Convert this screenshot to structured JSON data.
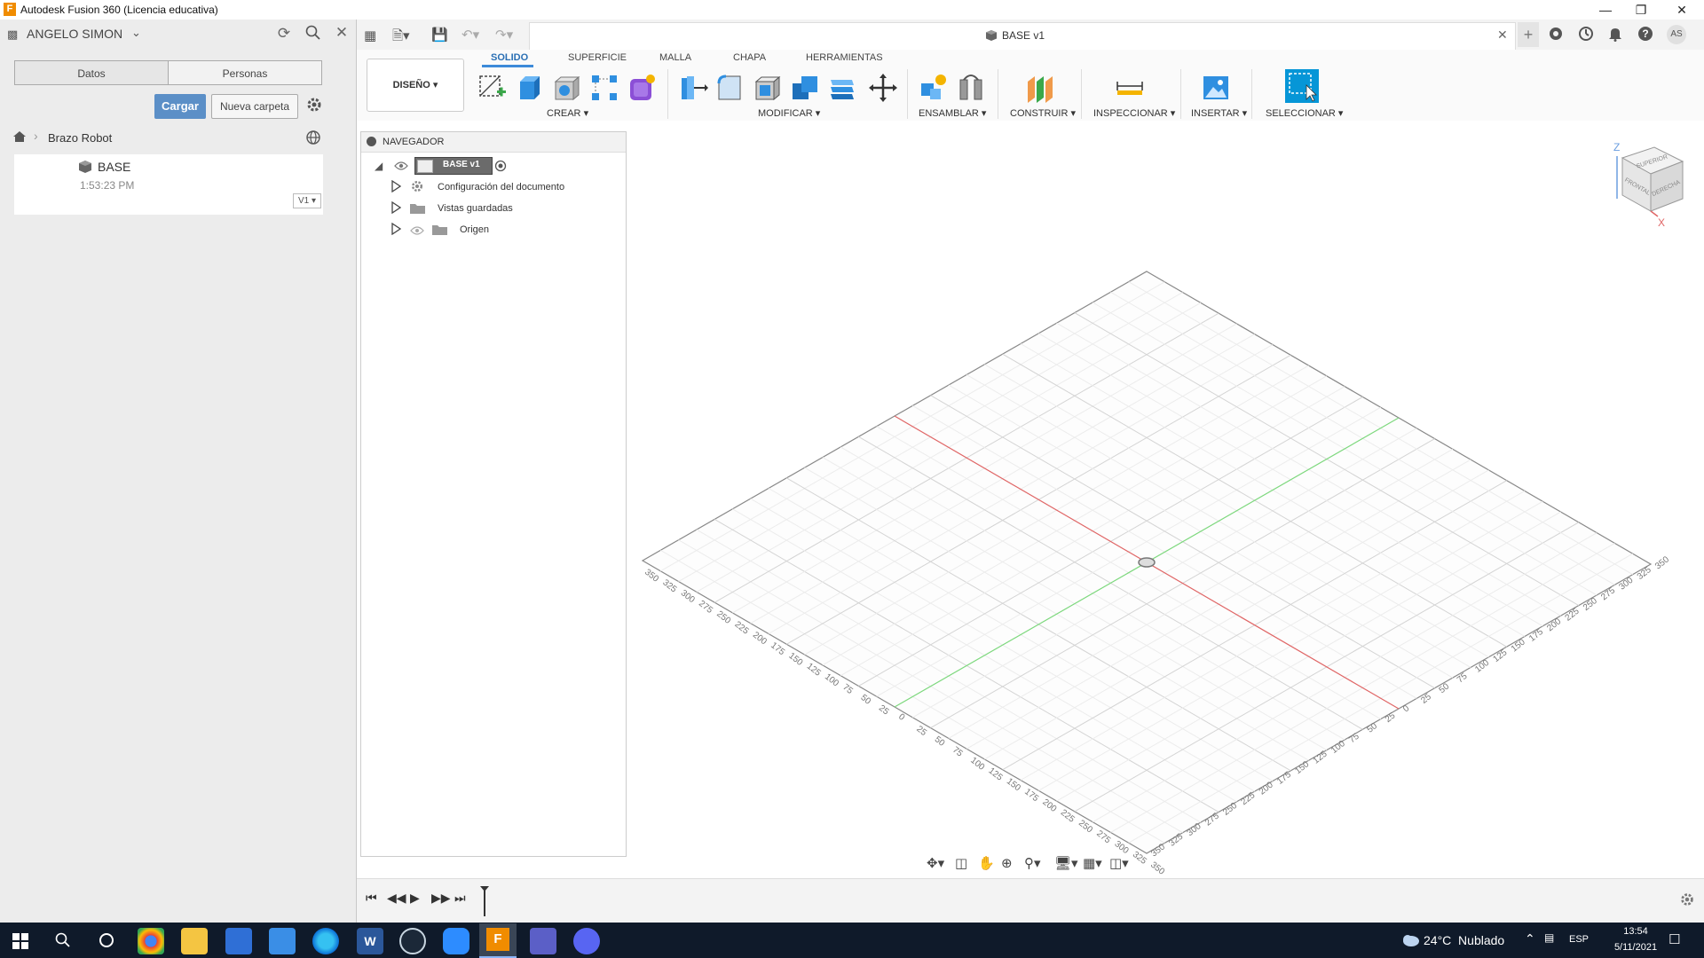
{
  "window": {
    "title": "Autodesk Fusion 360 (Licencia educativa)",
    "logo_letter": "F"
  },
  "data_panel": {
    "user_name": "ANGELO SIMON",
    "tabs": [
      {
        "label": "Datos"
      },
      {
        "label": "Personas"
      }
    ],
    "upload_label": "Cargar",
    "new_folder_label": "Nueva carpeta",
    "breadcrumb_project": "Brazo Robot",
    "file": {
      "name": "BASE",
      "time": "1:53:23 PM",
      "version": "V1"
    }
  },
  "document": {
    "tab_title": "BASE v1"
  },
  "ribbon": {
    "workspace": "DISEÑO",
    "tabs": [
      {
        "label": "SOLIDO",
        "active": true
      },
      {
        "label": "SUPERFICIE"
      },
      {
        "label": "MALLA"
      },
      {
        "label": "CHAPA"
      },
      {
        "label": "HERRAMIENTAS"
      }
    ],
    "groups": {
      "crear": "CREAR",
      "modificar": "MODIFICAR",
      "ensamblar": "ENSAMBLAR",
      "construir": "CONSTRUIR",
      "inspeccionar": "INSPECCIONAR",
      "insertar": "INSERTAR",
      "seleccionar": "SELECCIONAR"
    }
  },
  "navigator": {
    "header": "NAVEGADOR",
    "root": "BASE v1",
    "items": [
      {
        "label": "Configuración del documento"
      },
      {
        "label": "Vistas guardadas"
      },
      {
        "label": "Origen"
      }
    ]
  },
  "viewcube": {
    "axes": {
      "z": "Z",
      "x": "X"
    },
    "faces": {
      "top": "SUPERIOR",
      "front": "FRONTAL",
      "right": "DERECHA"
    }
  },
  "grid": {
    "tick_labels": [
      "25",
      "50",
      "75",
      "100",
      "125",
      "150",
      "175",
      "200",
      "225",
      "250",
      "275",
      "300",
      "325",
      "350"
    ],
    "origin_label": "0"
  },
  "user_initials": "AS",
  "taskbar": {
    "weather": "24°C  Nublado",
    "language": "ESP",
    "time": "13:54",
    "date": "5/11/2021"
  },
  "colors": {
    "accent": "#0696d7",
    "x_axis": "#e06666",
    "y_axis": "#7dd87d",
    "taskbar": "#0f1a2a"
  }
}
